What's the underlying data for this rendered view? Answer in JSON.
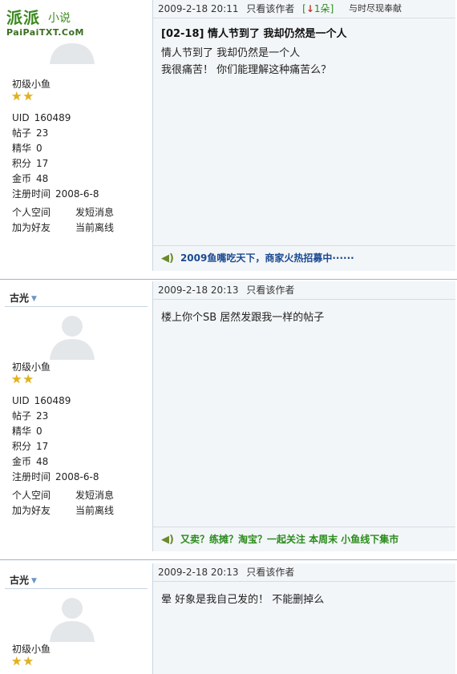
{
  "watermark": {
    "big": "派派",
    "small": "小说",
    "url": "PaiPaiTXT.CoM"
  },
  "posts": [
    {
      "author": "",
      "rank": "初级小鱼",
      "stars": "★★",
      "stats": [
        {
          "label": "UID",
          "value": "160489"
        },
        {
          "label": "帖子",
          "value": "23"
        },
        {
          "label": "精华",
          "value": "0"
        },
        {
          "label": "积分",
          "value": "17"
        },
        {
          "label": "金币",
          "value": "48"
        },
        {
          "label": "注册时间",
          "value": "2008-6-8"
        }
      ],
      "links": [
        "个人空间",
        "发短消息",
        "加为好友",
        "当前离线"
      ],
      "time": "2009-2-18 20:11",
      "only_author": "只看该作者",
      "flower": "1朵",
      "tagline": "与时尽现奉献",
      "title": "[02-18] 情人节到了  我却仍然是一个人",
      "body": [
        "情人节到了  我却仍然是一个人",
        "我很痛苦！  你们能理解这种痛苦么？"
      ],
      "ad": "2009鱼嘴吃天下，商家火热招募中······"
    },
    {
      "author": "古光",
      "rank": "初级小鱼",
      "stars": "★★",
      "stats": [
        {
          "label": "UID",
          "value": "160489"
        },
        {
          "label": "帖子",
          "value": "23"
        },
        {
          "label": "精华",
          "value": "0"
        },
        {
          "label": "积分",
          "value": "17"
        },
        {
          "label": "金币",
          "value": "48"
        },
        {
          "label": "注册时间",
          "value": "2008-6-8"
        }
      ],
      "links": [
        "个人空间",
        "发短消息",
        "加为好友",
        "当前离线"
      ],
      "time": "2009-2-18 20:13",
      "only_author": "只看该作者",
      "body": [
        "楼上你个SB 居然发跟我一样的帖子"
      ],
      "ad": "又卖？练摊？淘宝？一起关注  本周末  小鱼线下集市"
    },
    {
      "author": "古光",
      "rank": "初级小鱼",
      "stars": "★★",
      "time": "2009-2-18 20:13",
      "only_author": "只看该作者",
      "body": [
        "晕  好象是我自己发的！  不能删掉么"
      ]
    }
  ]
}
